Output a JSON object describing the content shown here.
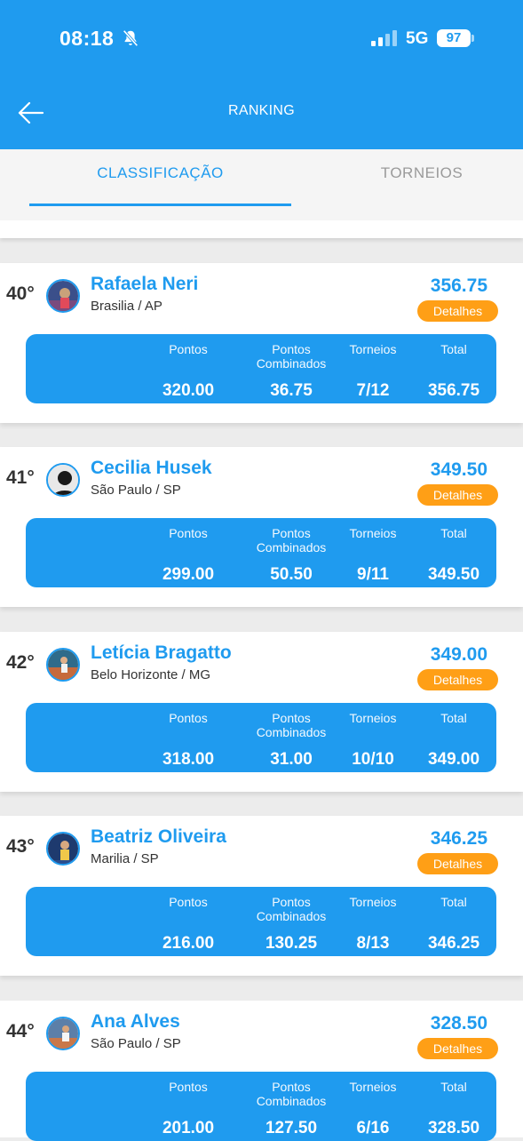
{
  "status_bar": {
    "time": "08:18",
    "network": "5G",
    "battery": "97"
  },
  "header": {
    "title": "RANKING"
  },
  "tabs": [
    {
      "label": "CLASSIFICAÇÃO"
    },
    {
      "label": "TORNEIOS"
    }
  ],
  "stat_labels": {
    "pontos": "Pontos",
    "combinados": "Pontos Combinados",
    "torneios": "Torneios",
    "total": "Total"
  },
  "button_label": "Detalhes",
  "players": [
    {
      "rank": "40°",
      "name": "Rafaela Neri",
      "city": "Brasilia / AP",
      "total": "356.75",
      "pontos": "320.00",
      "combinados": "36.75",
      "torneios": "7/12"
    },
    {
      "rank": "41°",
      "name": "Cecilia Husek",
      "city": "São Paulo / SP",
      "total": "349.50",
      "pontos": "299.00",
      "combinados": "50.50",
      "torneios": "9/11"
    },
    {
      "rank": "42°",
      "name": "Letícia Bragatto",
      "city": "Belo Horizonte / MG",
      "total": "349.00",
      "pontos": "318.00",
      "combinados": "31.00",
      "torneios": "10/10"
    },
    {
      "rank": "43°",
      "name": "Beatriz Oliveira",
      "city": "Marilia / SP",
      "total": "346.25",
      "pontos": "216.00",
      "combinados": "130.25",
      "torneios": "8/13"
    },
    {
      "rank": "44°",
      "name": "Ana Alves",
      "city": "São Paulo / SP",
      "total": "328.50",
      "pontos": "201.00",
      "combinados": "127.50",
      "torneios": "6/16"
    }
  ],
  "colors": {
    "primary": "#1f9bef",
    "accent": "#ff9f16"
  }
}
